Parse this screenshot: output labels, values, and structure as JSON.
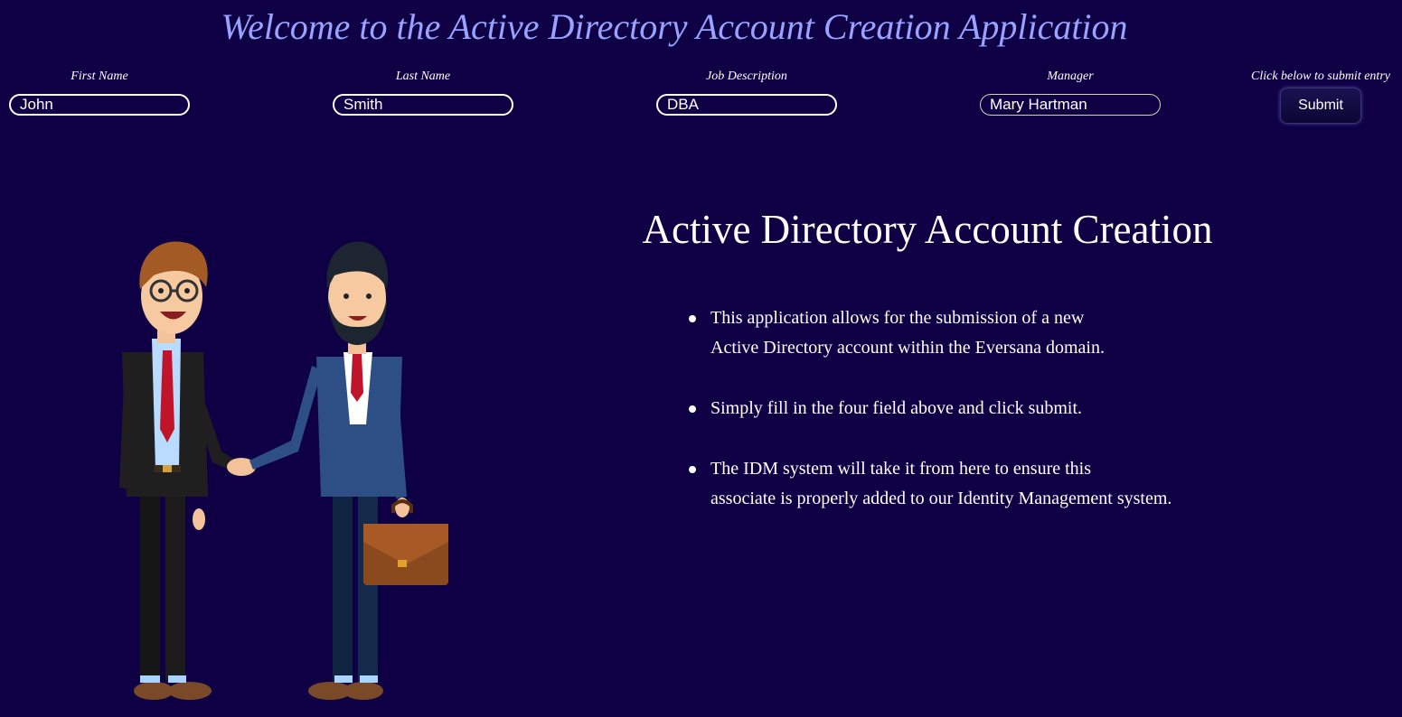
{
  "header": {
    "title": "Welcome to the Active Directory Account Creation Application"
  },
  "form": {
    "first_name": {
      "label": "First Name",
      "value": "John"
    },
    "last_name": {
      "label": "Last Name",
      "value": "Smith"
    },
    "job_description": {
      "label": "Job Description",
      "value": "DBA"
    },
    "manager": {
      "label": "Manager",
      "value": "Mary Hartman"
    },
    "submit": {
      "hint": "Click below to submit entry",
      "label": "Submit"
    }
  },
  "content": {
    "title": "Active Directory Account Creation",
    "bullets": [
      "This application allows for the submission of a new\nActive Directory account within the Eversana domain.",
      "Simply fill in the four field above and click submit.",
      "The IDM system will take it from here to ensure this\nassociate is properly added to our Identity Management system."
    ]
  },
  "illustration": {
    "icon": "businessmen-handshake-illustration"
  },
  "colors": {
    "background": "#0f0046",
    "title": "#9aa2ff",
    "text": "#ffffff"
  }
}
